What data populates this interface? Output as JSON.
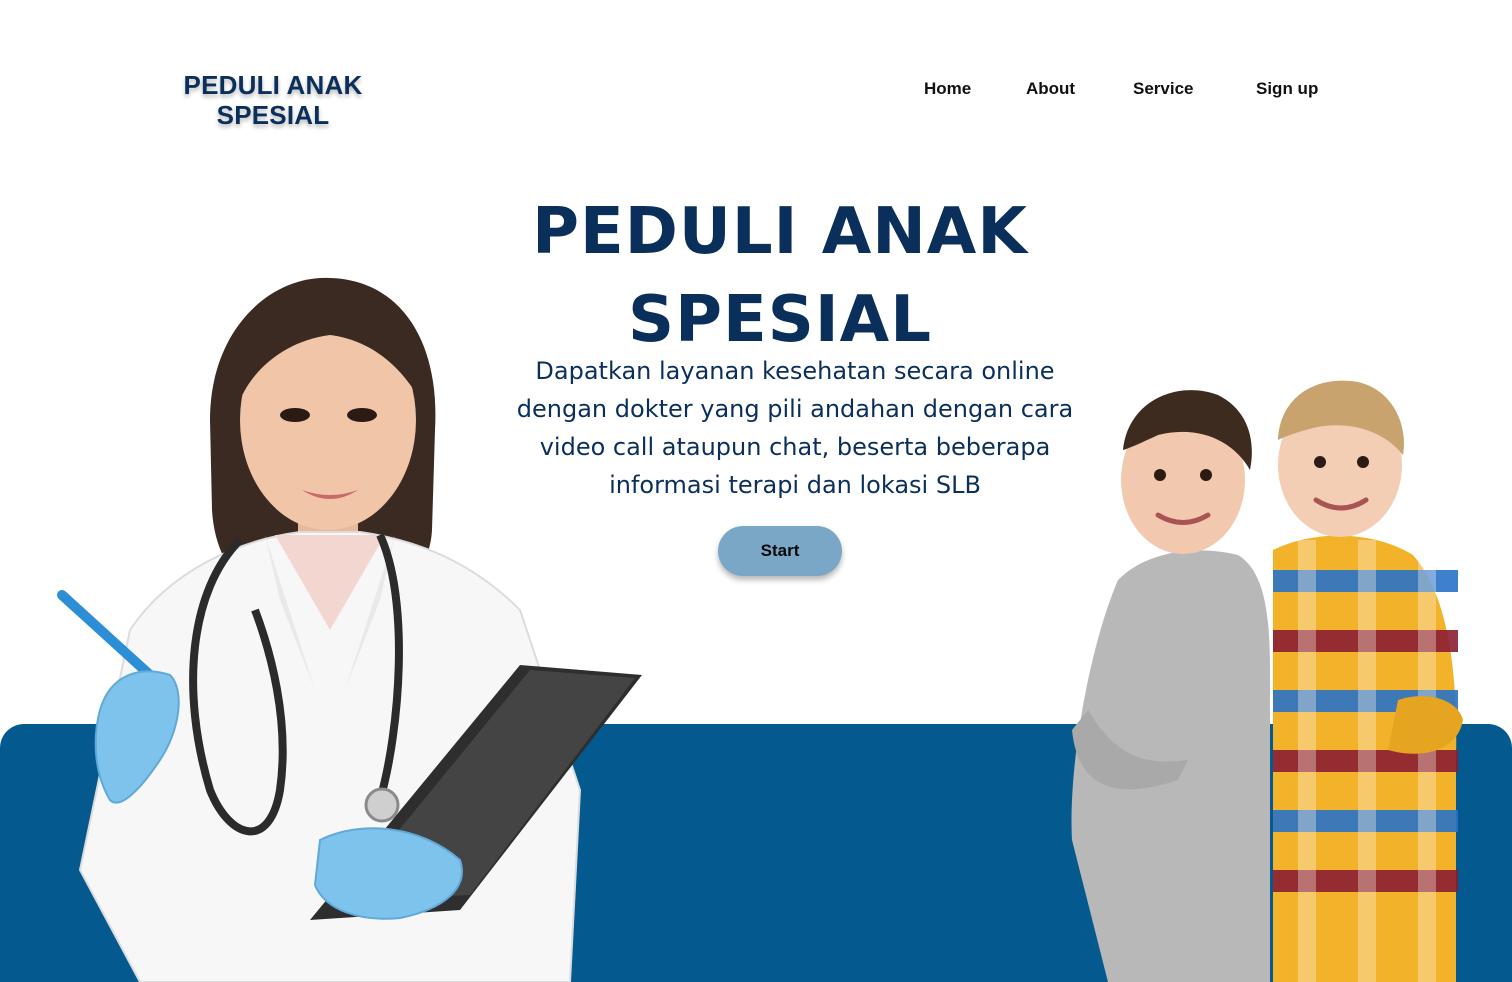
{
  "logo": {
    "line1": "PEDULI ANAK",
    "line2": "SPESIAL"
  },
  "nav": {
    "home": "Home",
    "about": "About",
    "service": "Service",
    "signup": "Sign up"
  },
  "hero": {
    "title_line1": "PEDULI ANAK",
    "title_line2": "SPESIAL",
    "subtitle": "Dapatkan layanan kesehatan secara online dengan dokter yang pili andahan dengan cara video call ataupun chat, beserta beberapa informasi terapi dan lokasi SLB",
    "cta_label": "Start"
  },
  "colors": {
    "brand_navy": "#0b2f5b",
    "band_blue": "#045a8f",
    "button_blue": "#7ba7c6",
    "background": "#ffffff"
  },
  "images": {
    "doctor": "doctor-photo",
    "kids": "kids-photo"
  }
}
